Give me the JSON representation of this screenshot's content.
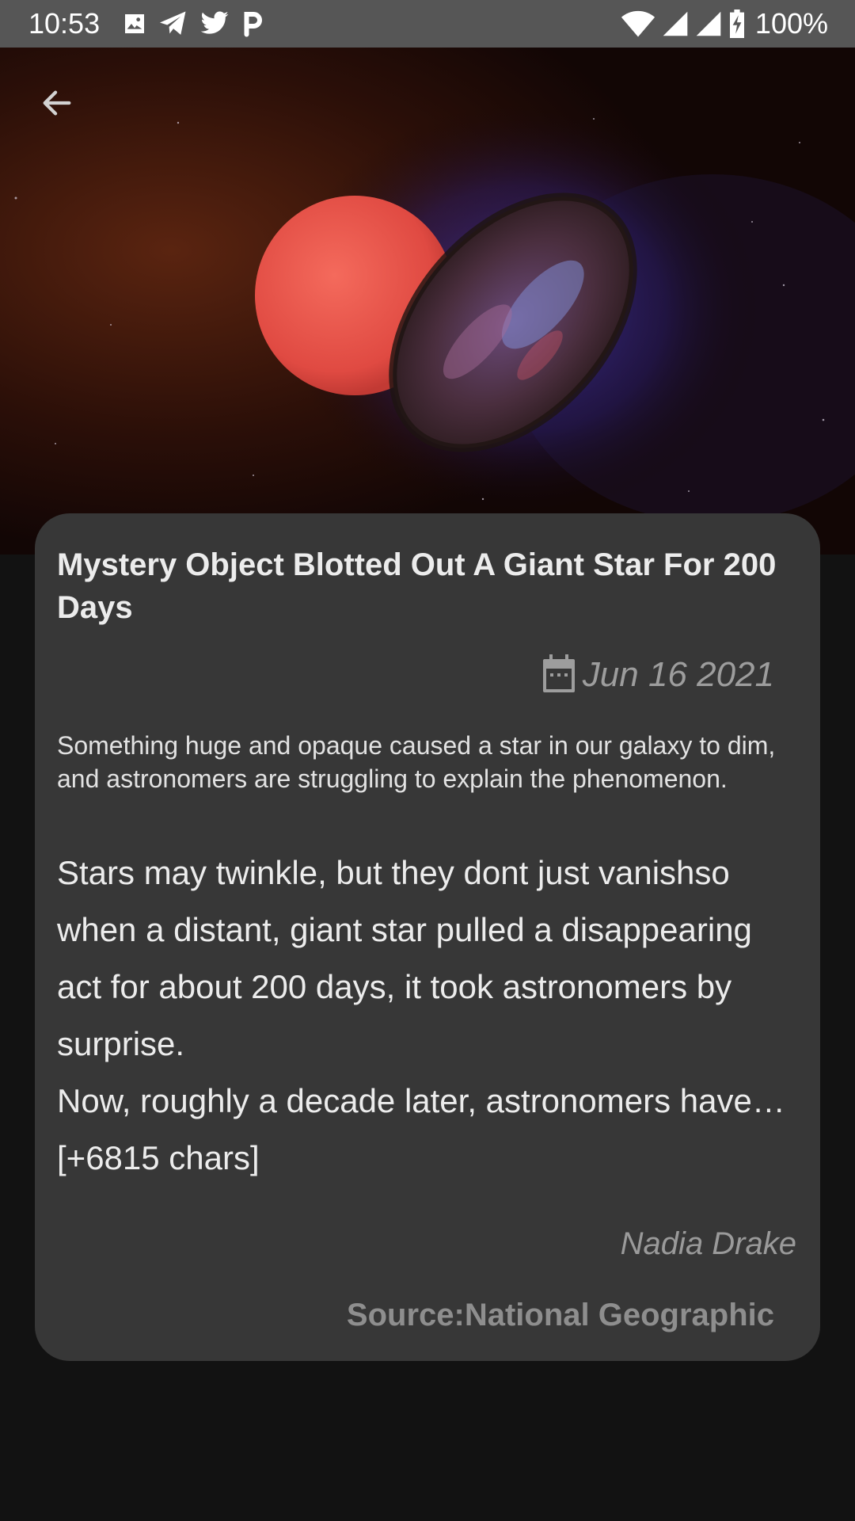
{
  "status_bar": {
    "time": "10:53",
    "notification_icons": [
      "image-icon",
      "telegram-icon",
      "twitter-icon",
      "p-icon"
    ],
    "system_icons": [
      "wifi-icon",
      "cell-signal-icon",
      "cell-signal-icon",
      "battery-charging-icon"
    ],
    "battery": "100%"
  },
  "toolbar": {
    "back_icon": "arrow-left-icon"
  },
  "article": {
    "title": "Mystery Object Blotted Out A Giant Star For 200 Days",
    "date": "Jun 16 2021",
    "date_icon": "calendar-icon",
    "description": "Something huge and opaque caused a star in our galaxy to dim, and astronomers are struggling to explain the phenomenon.",
    "content": "Stars may twinkle, but they dont just vanishso when a distant, giant star pulled a disappearing act for about 200 days, it took astronomers by surprise.\nNow, roughly a decade later, astronomers have… [+6815 chars]",
    "author": "Nadia Drake",
    "source": "Source:National Geographic"
  },
  "colors": {
    "background": "#121212",
    "card": "#373737",
    "status_bar": "#565656",
    "star": "#e4544a"
  }
}
